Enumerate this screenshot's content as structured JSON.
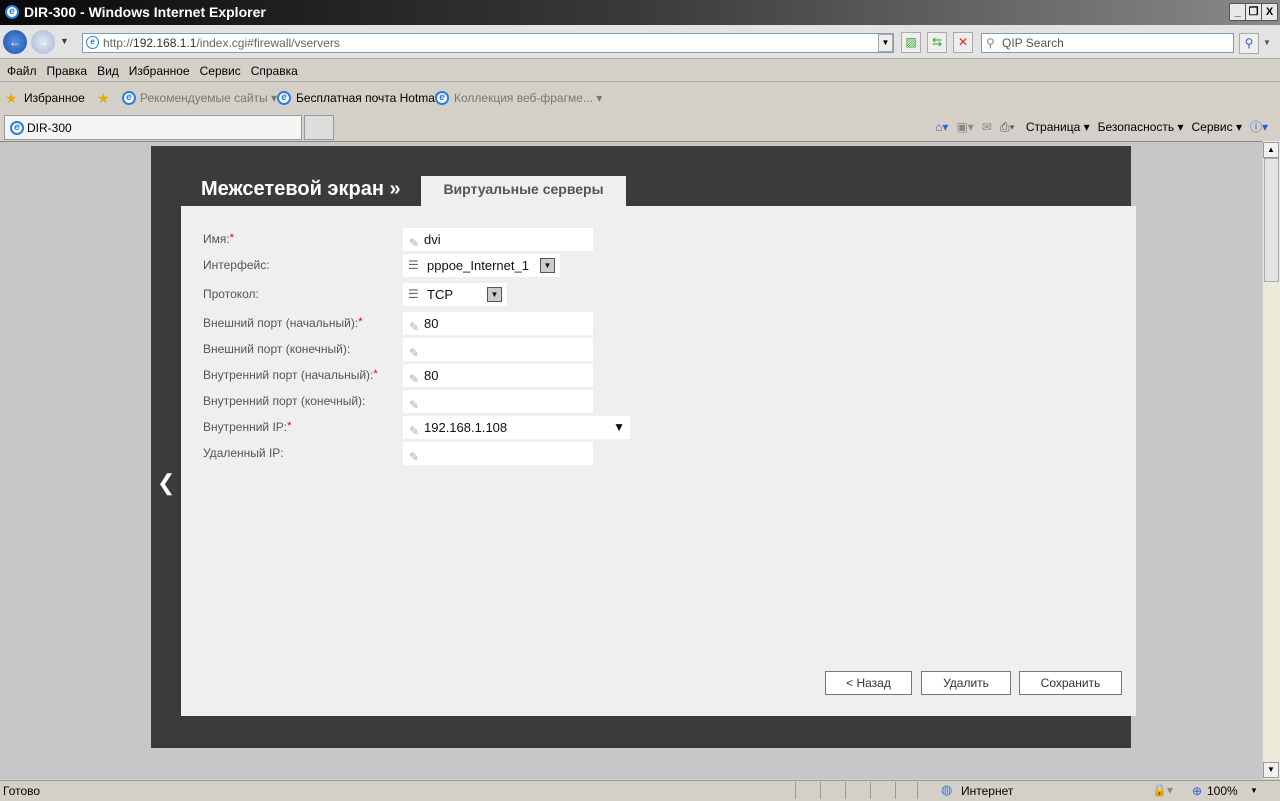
{
  "window": {
    "title": "DIR-300 - Windows Internet Explorer",
    "min": "_",
    "restore": "❐",
    "close": "X"
  },
  "address": {
    "prefix": "http://",
    "host": "192.168.1.1",
    "path": "/index.cgi#firewall/vservers"
  },
  "search": {
    "placeholder": "QIP Search"
  },
  "menu": [
    "Файл",
    "Правка",
    "Вид",
    "Избранное",
    "Сервис",
    "Справка"
  ],
  "favorites": {
    "label": "Избранное",
    "items": [
      "Рекомендуемые сайты ▾",
      "Бесплатная почта Hotmail",
      "Коллекция веб-фрагме... ▾"
    ]
  },
  "tab": {
    "label": "DIR-300"
  },
  "commandbar": [
    "Страница ▾",
    "Безопасность ▾",
    "Сервис ▾"
  ],
  "page": {
    "title": "Межсетевой экран »",
    "tab": "Виртуальные серверы"
  },
  "form": {
    "name": {
      "label": "Имя:",
      "value": "dvi"
    },
    "interface": {
      "label": "Интерфейс:",
      "value": "pppoe_Internet_1"
    },
    "protocol": {
      "label": "Протокол:",
      "value": "TCP"
    },
    "ext_start": {
      "label": "Внешний порт (начальный):",
      "value": "80"
    },
    "ext_end": {
      "label": "Внешний порт (конечный):",
      "value": ""
    },
    "int_start": {
      "label": "Внутренний порт (начальный):",
      "value": "80"
    },
    "int_end": {
      "label": "Внутренний порт (конечный):",
      "value": ""
    },
    "int_ip": {
      "label": "Внутренний IP:",
      "value": "192.168.1.108"
    },
    "remote_ip": {
      "label": "Удаленный IP:",
      "value": ""
    },
    "required_mark": "*"
  },
  "buttons": {
    "back": "< Назад",
    "delete": "Удалить",
    "save": "Сохранить"
  },
  "status": {
    "text": "Готово",
    "zone": "Интернет",
    "zoom": "100%"
  }
}
